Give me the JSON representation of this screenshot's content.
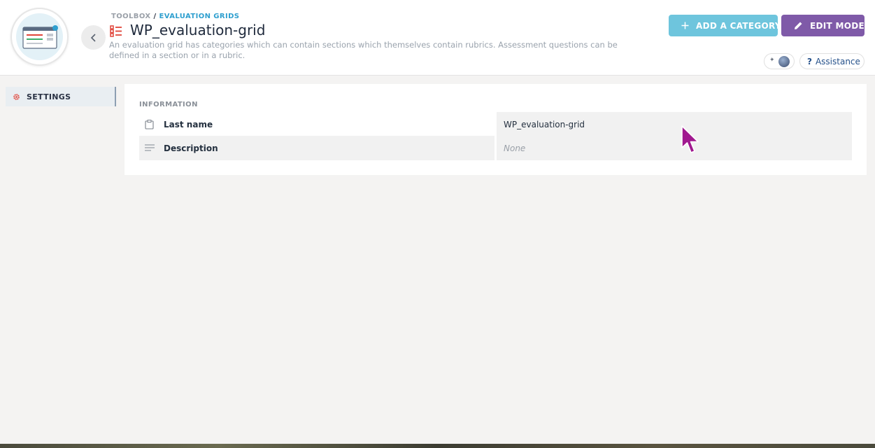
{
  "breadcrumb": {
    "items": [
      "TOOLBOX",
      "EVALUATION GRIDS"
    ],
    "separator": "/"
  },
  "page": {
    "title": "WP_evaluation-grid",
    "description": "An evaluation grid has categories which can contain sections which themselves contain rubrics. Assessment questions can be defined in a section or in a rubric."
  },
  "toolbar": {
    "add_category_label": "ADD A CATEGORY",
    "edit_mode_label": "EDIT MODE",
    "assistance_label": "Assistance",
    "assistance_icon_text": "?"
  },
  "sidebar": {
    "items": [
      {
        "label": "SETTINGS",
        "icon": "gear-icon",
        "active": true
      }
    ]
  },
  "information": {
    "section_label": "INFORMATION",
    "rows": [
      {
        "label": "Last name",
        "value": "WP_evaluation-grid",
        "icon": "clipboard-icon"
      },
      {
        "label": "Description",
        "value": "None",
        "icon": "lines-icon"
      }
    ]
  },
  "colors": {
    "accent_blue": "#6ec5dd",
    "accent_purple": "#7f5aa8",
    "link_blue": "#2e9fcf",
    "title_icon_red": "#e0453a",
    "cursor_magenta": "#a0198f"
  }
}
